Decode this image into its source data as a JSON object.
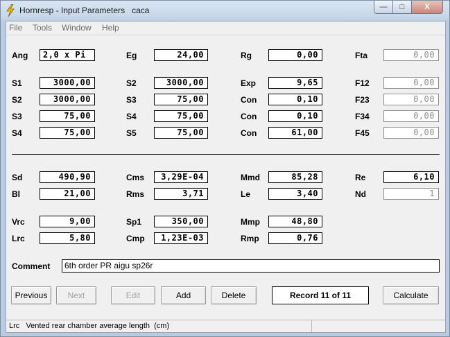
{
  "window": {
    "title": "Hornresp - Input Parameters",
    "doc_name": "caca",
    "controls": {
      "minimize": "—",
      "maximize": "□",
      "close": "X"
    }
  },
  "menu": [
    "File",
    "Tools",
    "Window",
    "Help"
  ],
  "params": {
    "ang": {
      "label": "Ang",
      "value": "2,0 x Pi"
    },
    "eg": {
      "label": "Eg",
      "value": "24,00"
    },
    "rg": {
      "label": "Rg",
      "value": "0,00"
    },
    "fta": {
      "label": "Fta",
      "value": "0,00"
    },
    "s1": {
      "label": "S1",
      "value": "3000,00"
    },
    "s2a": {
      "label": "S2",
      "value": "3000,00"
    },
    "exp": {
      "label": "Exp",
      "value": "9,65"
    },
    "f12": {
      "label": "F12",
      "value": "0,00"
    },
    "s2b": {
      "label": "S2",
      "value": "3000,00"
    },
    "s3a": {
      "label": "S3",
      "value": "75,00"
    },
    "con1": {
      "label": "Con",
      "value": "0,10"
    },
    "f23": {
      "label": "F23",
      "value": "0,00"
    },
    "s3b": {
      "label": "S3",
      "value": "75,00"
    },
    "s4a": {
      "label": "S4",
      "value": "75,00"
    },
    "con2": {
      "label": "Con",
      "value": "0,10"
    },
    "f34": {
      "label": "F34",
      "value": "0,00"
    },
    "s4b": {
      "label": "S4",
      "value": "75,00"
    },
    "s5": {
      "label": "S5",
      "value": "75,00"
    },
    "con3": {
      "label": "Con",
      "value": "61,00"
    },
    "f45": {
      "label": "F45",
      "value": "0,00"
    },
    "sd": {
      "label": "Sd",
      "value": "490,90"
    },
    "cms": {
      "label": "Cms",
      "value": "3,29E-04"
    },
    "mmd": {
      "label": "Mmd",
      "value": "85,28"
    },
    "re": {
      "label": "Re",
      "value": "6,10"
    },
    "bl": {
      "label": "Bl",
      "value": "21,00"
    },
    "rms": {
      "label": "Rms",
      "value": "3,71"
    },
    "le": {
      "label": "Le",
      "value": "3,40"
    },
    "nd": {
      "label": "Nd",
      "value": "1"
    },
    "vrc": {
      "label": "Vrc",
      "value": "9,00"
    },
    "sp1": {
      "label": "Sp1",
      "value": "350,00"
    },
    "mmp": {
      "label": "Mmp",
      "value": "48,80"
    },
    "lrc": {
      "label": "Lrc",
      "value": "5,80"
    },
    "cmp": {
      "label": "Cmp",
      "value": "1,23E-03"
    },
    "rmp": {
      "label": "Rmp",
      "value": "0,76"
    }
  },
  "comment": {
    "label": "Comment",
    "value": "6th order PR aigu sp26r"
  },
  "buttons": {
    "previous": "Previous",
    "next": "Next",
    "edit": "Edit",
    "add": "Add",
    "delete": "Delete",
    "calculate": "Calculate"
  },
  "record": "Record 11 of 11",
  "status": "Lrc   Vented rear chamber average length  (cm)",
  "colors": {
    "accent_icon": "#f5c400",
    "disabled_text": "#8e8e8e"
  }
}
